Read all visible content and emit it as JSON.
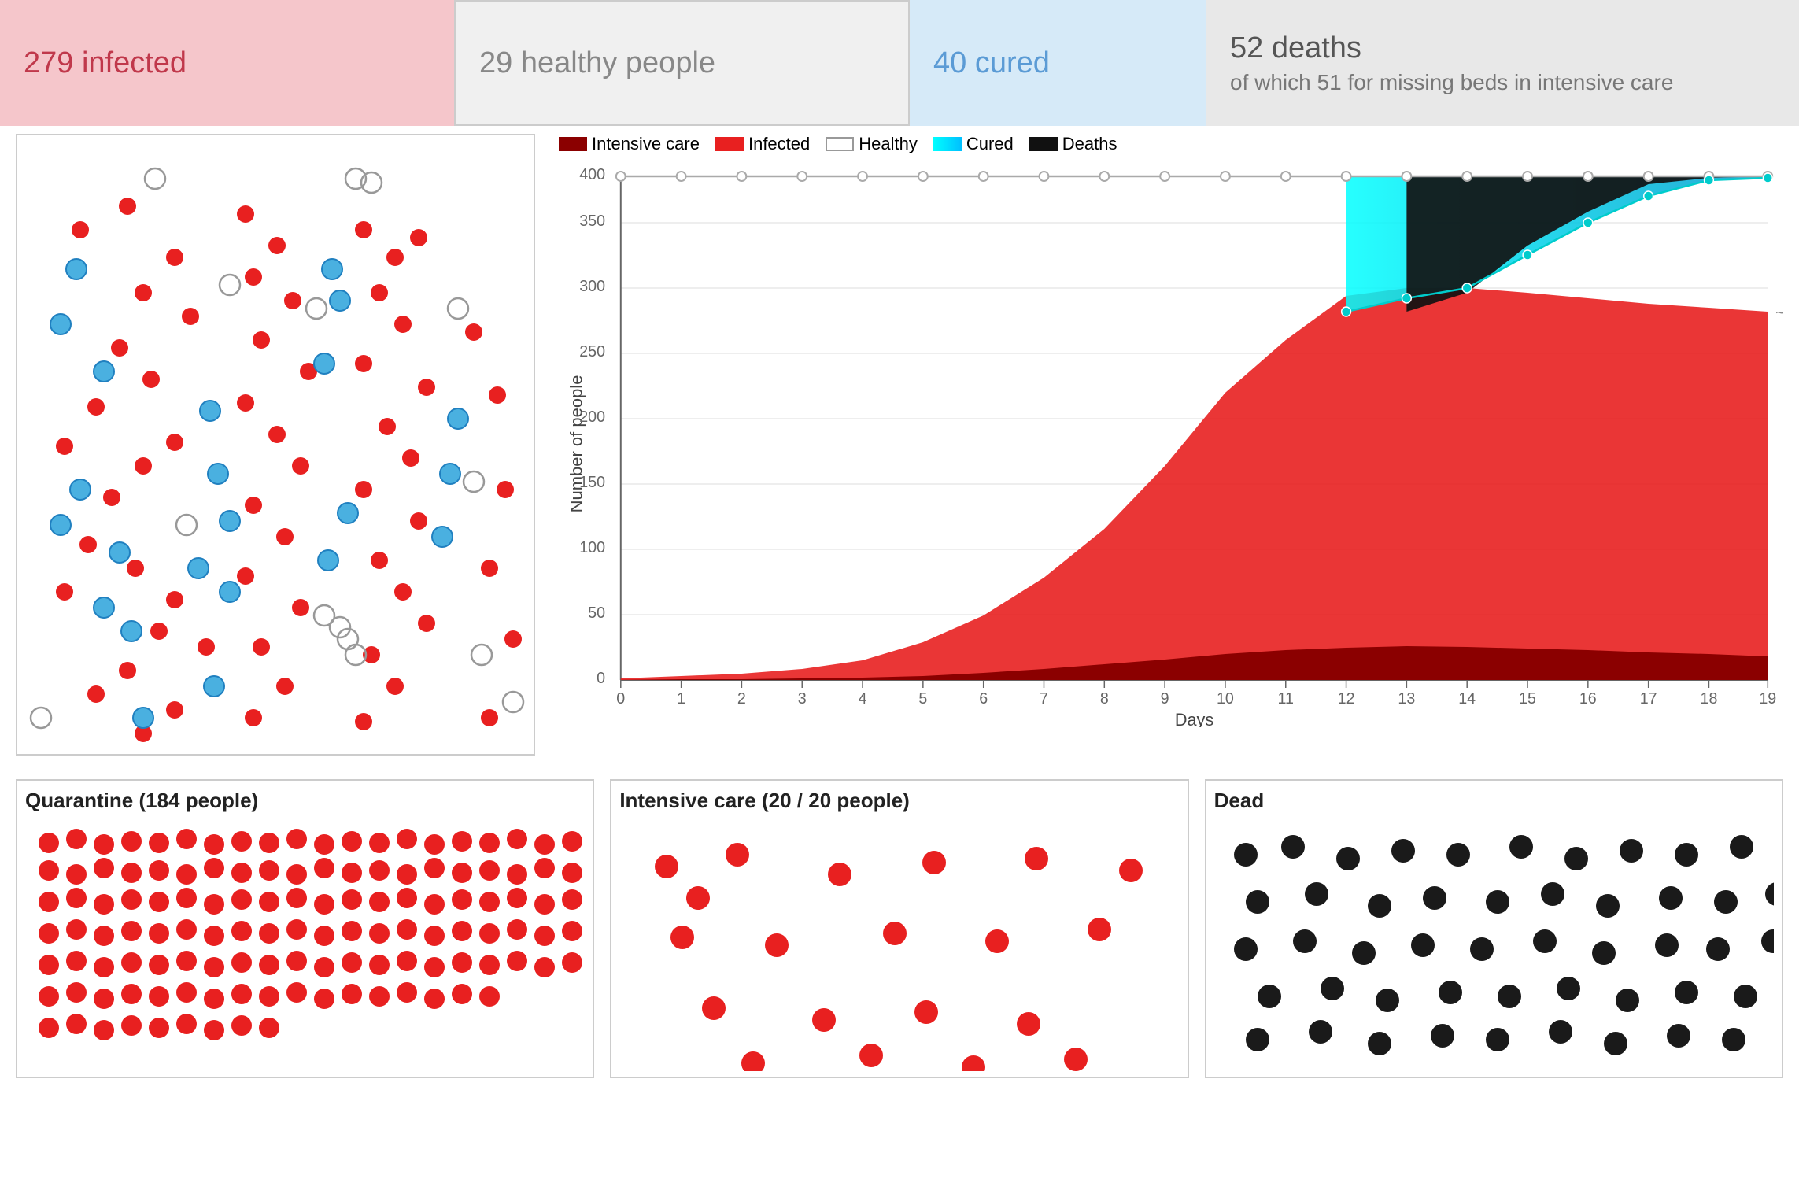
{
  "stats": {
    "infected": {
      "label": "279 infected",
      "bg": "#f5c6cb",
      "color": "#c0384b"
    },
    "healthy": {
      "label": "29 healthy people",
      "bg": "#f0f0f0",
      "color": "#888"
    },
    "cured": {
      "label": "40 cured",
      "bg": "#d6eaf8",
      "color": "#5b9bd5"
    },
    "deaths_main": "52 deaths",
    "deaths_sub": "of which 51 for missing beds in intensive care",
    "deaths_bg": "#e8e8e8",
    "deaths_color": "#555"
  },
  "legend": {
    "items": [
      {
        "key": "intensive",
        "label": "Intensive care",
        "color": "#8B0000"
      },
      {
        "key": "infected",
        "label": "Infected",
        "color": "#e82020"
      },
      {
        "key": "healthy",
        "label": "Healthy",
        "color": "#999"
      },
      {
        "key": "cured",
        "label": "Cured",
        "color": "#00d4d4"
      },
      {
        "key": "deaths",
        "label": "Deaths",
        "color": "#111"
      }
    ]
  },
  "chart": {
    "y_label": "Number of people",
    "x_label": "Days",
    "y_max": 400,
    "y_ticks": [
      0,
      50,
      100,
      150,
      200,
      250,
      300,
      350,
      400
    ],
    "x_ticks": [
      0,
      1,
      2,
      3,
      4,
      5,
      6,
      7,
      8,
      9,
      10,
      11,
      12,
      13,
      14,
      15,
      16,
      17,
      18,
      19
    ]
  },
  "bottom": {
    "quarantine": {
      "title": "Quarantine (184 people)"
    },
    "intensive": {
      "title": "Intensive care (20 / 20 people)"
    },
    "dead": {
      "title": "Dead"
    }
  }
}
